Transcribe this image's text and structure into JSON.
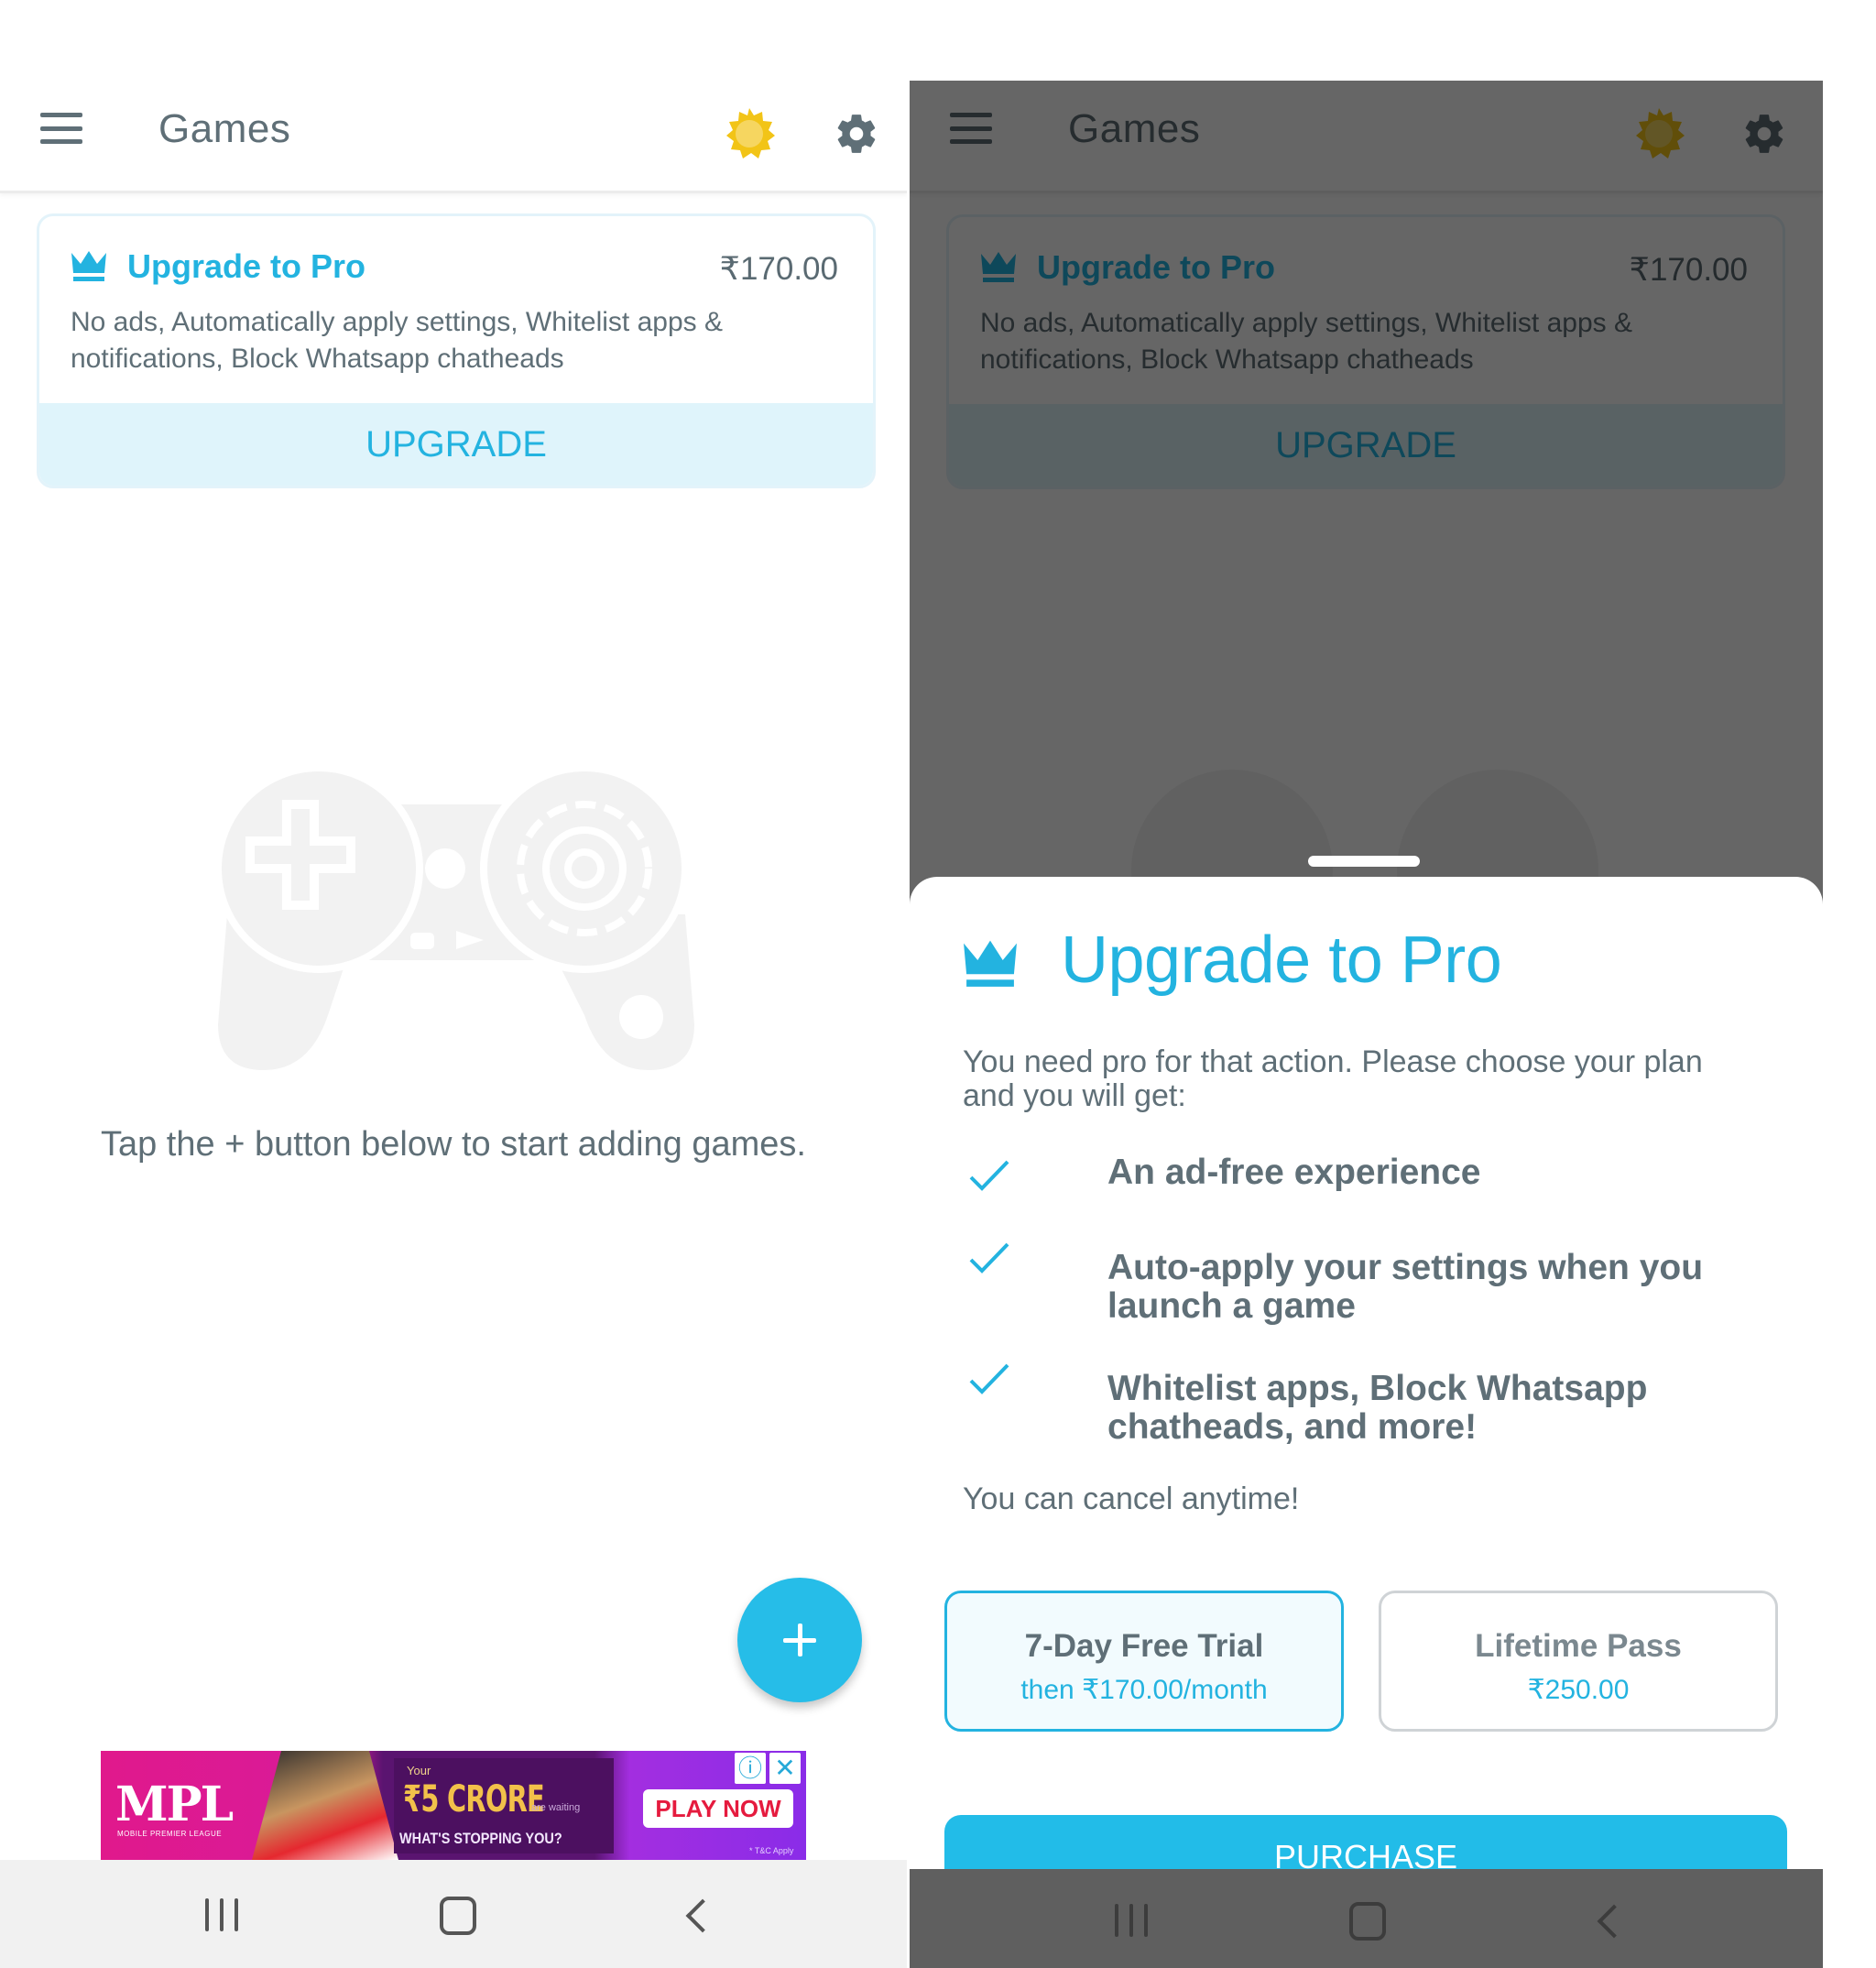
{
  "left_screen": {
    "app_bar": {
      "menu_icon": "hamburger-menu-icon",
      "title": "Games",
      "theme_icon": "sun-icon",
      "settings_icon": "gear-icon"
    },
    "upgrade_card": {
      "icon": "crown-icon",
      "title": "Upgrade to Pro",
      "price": "₹170.00",
      "description": "No ads, Automatically apply settings, Whitelist apps & notifications, Block Whatsapp chatheads",
      "button_label": "UPGRADE"
    },
    "empty_state": {
      "illustration": "gamepad-gear-icon",
      "message": "Tap the + button below to start adding games."
    },
    "fab": {
      "icon": "plus-icon",
      "label": "+"
    },
    "ad_banner": {
      "brand": "MPL",
      "brand_subtitle": "MOBILE PREMIER LEAGUE",
      "line1": "Your",
      "headline": "₹5 CRORE",
      "line2": "are waiting",
      "tagline": "WHAT'S STOPPING YOU?",
      "cta": "PLAY NOW",
      "info_icon": "ⓘ",
      "close_icon": "✕",
      "disclaimer": "* T&C Apply"
    },
    "nav_bar": {
      "recents": "recents-icon",
      "home": "home-icon",
      "back": "back-icon"
    }
  },
  "right_screen": {
    "app_bar": {
      "title": "Games"
    },
    "upgrade_card": {
      "title": "Upgrade to Pro",
      "price": "₹170.00",
      "description": "No ads, Automatically apply settings, Whitelist apps & notifications, Block Whatsapp chatheads",
      "button_label": "UPGRADE"
    },
    "bottom_sheet": {
      "title": "Upgrade to Pro",
      "description": "You need pro for that action. Please choose your plan and you will get:",
      "features": [
        "An ad-free experience",
        "Auto-apply your settings when you launch a game",
        "Whitelist apps, Block Whatsapp chatheads, and more!"
      ],
      "cancel_note": "You can cancel anytime!",
      "plans": [
        {
          "name": "7-Day Free Trial",
          "price": "then ₹170.00/month",
          "selected": true
        },
        {
          "name": "Lifetime Pass",
          "price": "₹250.00",
          "selected": false
        }
      ],
      "purchase_label": "PURCHASE"
    }
  },
  "colors": {
    "accent": "#23b3e0",
    "fab": "#26bde8",
    "text": "#5f6f77",
    "sun": "#f2c417",
    "upgrade_band": "#dff4fb",
    "scrim": "#666666"
  }
}
